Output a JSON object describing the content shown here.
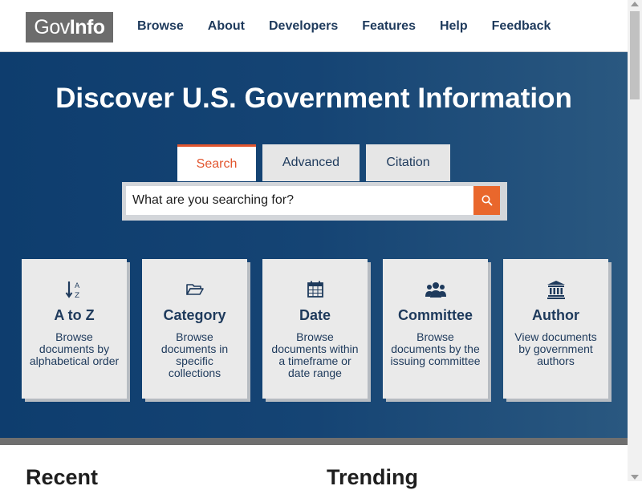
{
  "header": {
    "logo": {
      "part1": "Gov",
      "part2": "Info"
    },
    "nav": [
      "Browse",
      "About",
      "Developers",
      "Features",
      "Help",
      "Feedback"
    ]
  },
  "hero": {
    "title": "Discover U.S. Government Information",
    "tabs": [
      {
        "label": "Search",
        "active": true
      },
      {
        "label": "Advanced",
        "active": false
      },
      {
        "label": "Citation",
        "active": false
      }
    ],
    "search": {
      "placeholder": "What are you searching for?",
      "button_icon": "search-icon"
    }
  },
  "cards": [
    {
      "icon": "sort-alpha-icon",
      "title": "A to Z",
      "desc": "Browse documents by alphabetical order"
    },
    {
      "icon": "folder-open-icon",
      "title": "Category",
      "desc": "Browse documents in specific collections"
    },
    {
      "icon": "calendar-icon",
      "title": "Date",
      "desc": "Browse documents within a timeframe or date range"
    },
    {
      "icon": "users-icon",
      "title": "Committee",
      "desc": "Browse documents by the issuing committee"
    },
    {
      "icon": "institution-icon",
      "title": "Author",
      "desc": "View documents by government authors"
    }
  ],
  "sections": [
    "Recent",
    "Trending"
  ],
  "colors": {
    "brand": "#154474",
    "accent": "#e9672c",
    "text": "#1e3a5c"
  }
}
